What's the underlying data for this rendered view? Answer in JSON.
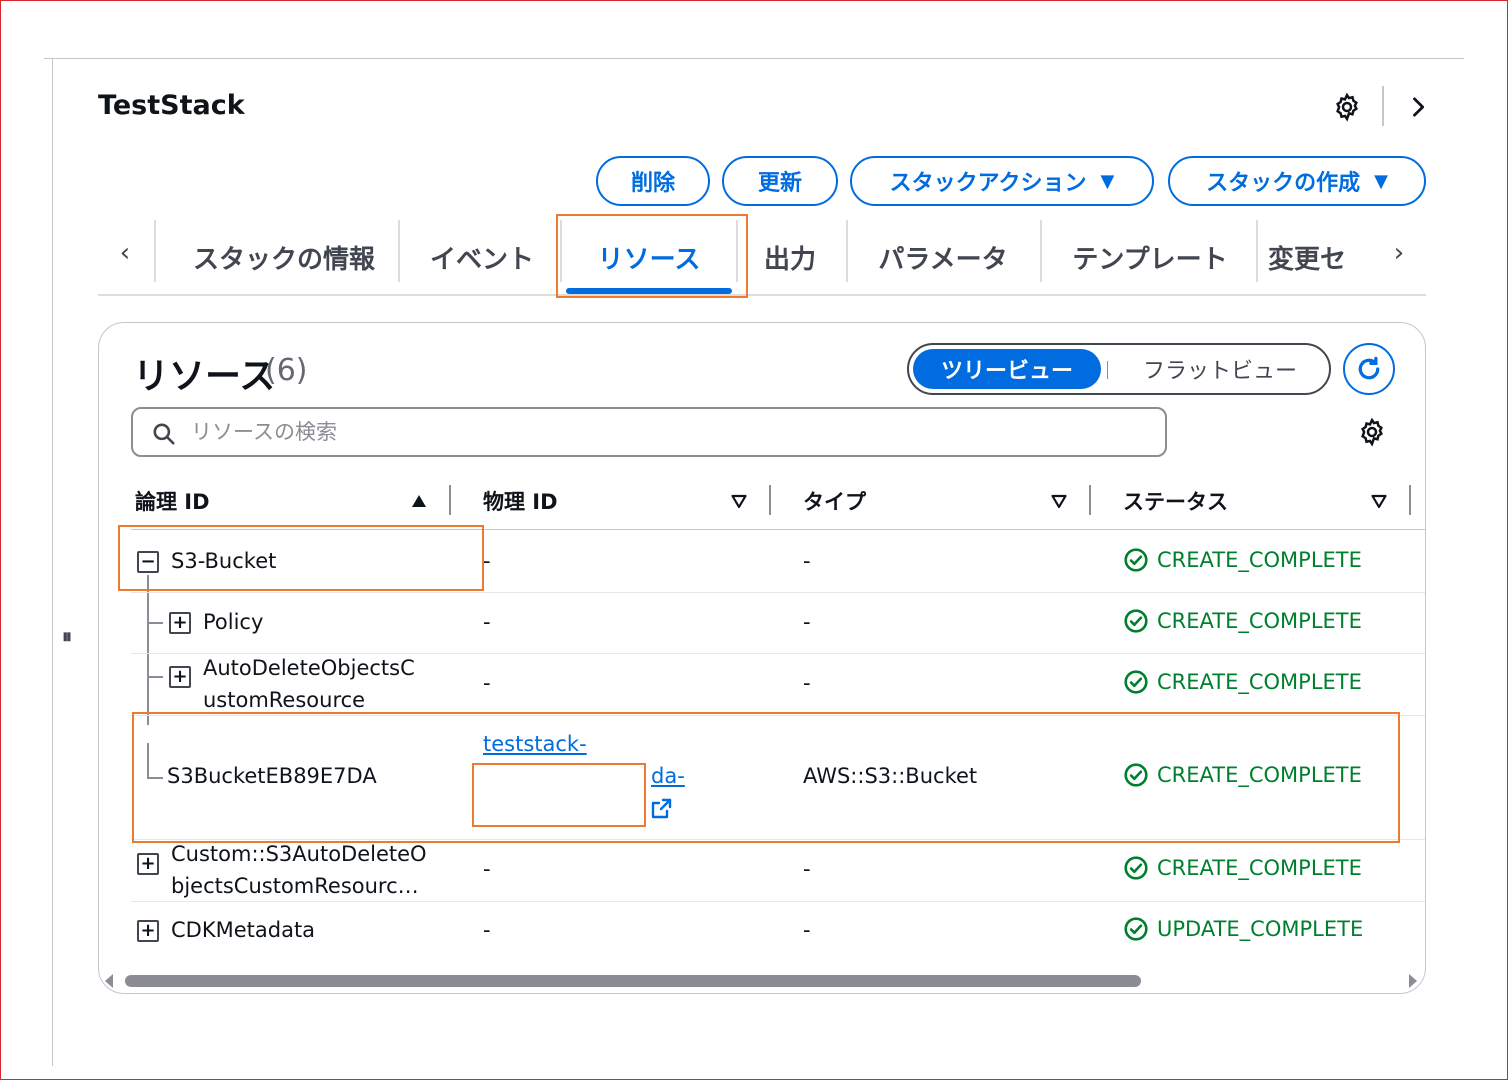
{
  "stack": {
    "title": "TestStack"
  },
  "actions": {
    "delete_label": "削除",
    "update_label": "更新",
    "stack_actions_label": "スタックアクション",
    "create_stack_label": "スタックの作成",
    "caret": "▼"
  },
  "tabs": [
    {
      "label": "スタックの情報"
    },
    {
      "label": "イベント"
    },
    {
      "label": "リソース"
    },
    {
      "label": "出力"
    },
    {
      "label": "パラメータ"
    },
    {
      "label": "テンプレート"
    },
    {
      "label": "変更セ"
    }
  ],
  "active_tab": "リソース",
  "resources": {
    "title": "リソース",
    "count": "(6)",
    "view_toggle": {
      "tree": "ツリービュー",
      "flat": "フラットビュー",
      "selected": "ツリービュー"
    },
    "search_placeholder": "リソースの検索",
    "columns": [
      {
        "label": "論理 ID",
        "sort": "▲"
      },
      {
        "label": "物理 ID",
        "sort": "▽"
      },
      {
        "label": "タイプ",
        "sort": "▽"
      },
      {
        "label": "ステータス",
        "sort": "▽"
      }
    ],
    "rows": [
      {
        "logical_id": "S3-Bucket",
        "expander": "−",
        "physical_id": "-",
        "type": "-",
        "status": "CREATE_COMPLETE"
      },
      {
        "logical_id": "Policy",
        "expander": "+",
        "physical_id": "-",
        "type": "-",
        "status": "CREATE_COMPLETE"
      },
      {
        "logical_id_line1": "AutoDeleteObjectsC",
        "logical_id_line2": "ustomResource",
        "expander": "+",
        "physical_id": "-",
        "type": "-",
        "status": "CREATE_COMPLETE"
      },
      {
        "logical_id": "S3BucketEB89E7DA",
        "physical_id_line1": "teststack-",
        "physical_id_line2": "da-",
        "type": "AWS::S3::Bucket",
        "status": "CREATE_COMPLETE"
      },
      {
        "logical_id_line1": "Custom::S3AutoDeleteO",
        "logical_id_line2": "bjectsCustomResourc…",
        "expander": "+",
        "physical_id": "-",
        "type": "-",
        "status": "CREATE_COMPLETE"
      },
      {
        "logical_id": "CDKMetadata",
        "expander": "+",
        "physical_id": "-",
        "type": "-",
        "status": "UPDATE_COMPLETE"
      }
    ]
  },
  "colors": {
    "accent": "#006ce0",
    "success": "#00802f",
    "highlight": "#ec7a31",
    "frame": "#d9252b"
  },
  "icons": {
    "settings": "gear-icon",
    "next": "chevron-right-icon",
    "refresh": "refresh-icon",
    "search": "search-icon",
    "status": "check-circle-icon",
    "external": "external-link-icon"
  }
}
